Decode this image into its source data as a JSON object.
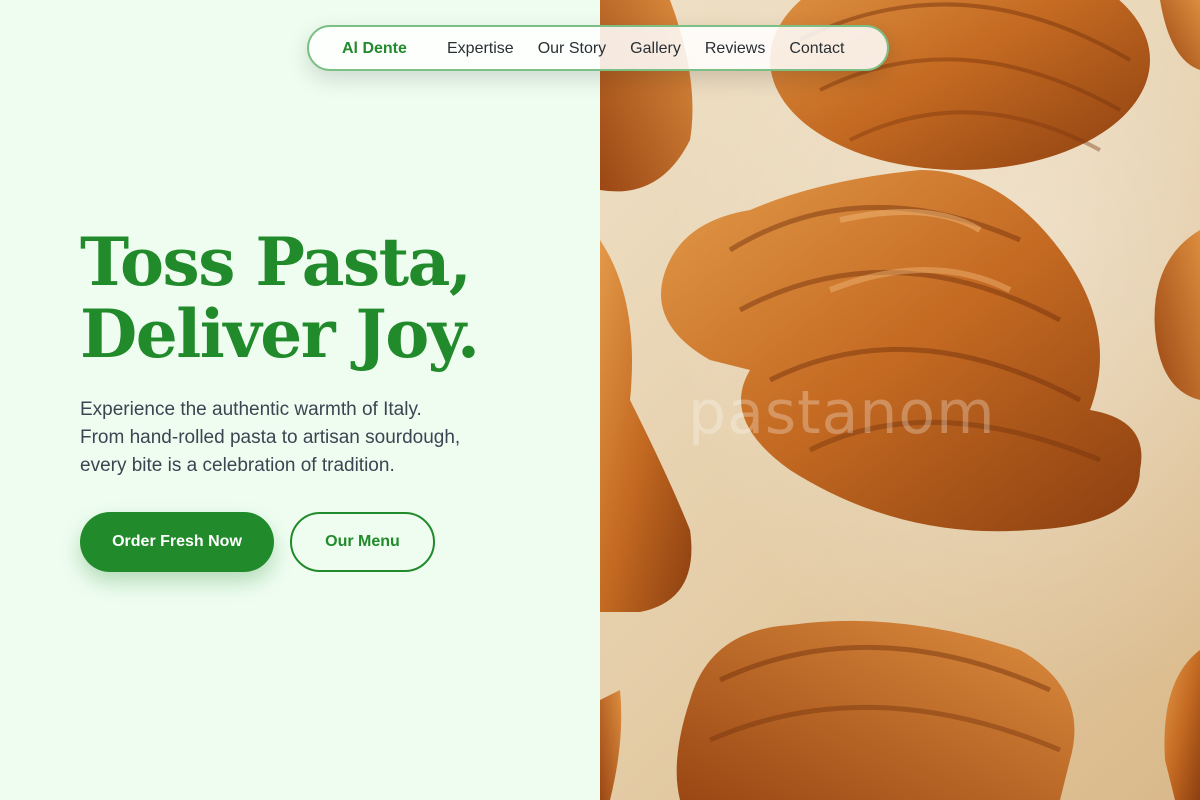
{
  "nav": {
    "brand": "Al Dente",
    "links": [
      "Expertise",
      "Our Story",
      "Gallery",
      "Reviews",
      "Contact"
    ]
  },
  "hero": {
    "headline_line1": "Toss Pasta,",
    "headline_line2": "Deliver Joy.",
    "description_lines": [
      "Experience the authentic warmth of Italy.",
      "From hand-rolled pasta to artisan sourdough,",
      "every bite is a celebration of tradition."
    ],
    "primary_button": "Order Fresh Now",
    "secondary_button": "Our Menu",
    "image_watermark": "pastanom"
  },
  "colors": {
    "accent": "#218a2a",
    "background": "#effdf1",
    "text": "#3b4552"
  }
}
